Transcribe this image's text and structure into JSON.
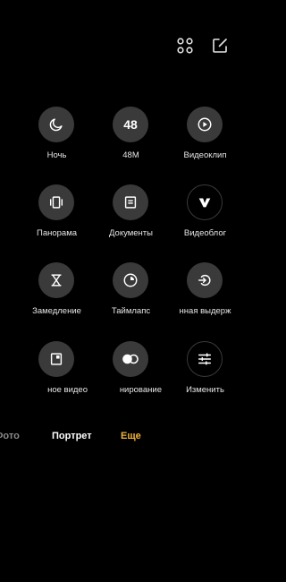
{
  "toolbar": {
    "icons": [
      "grid-icon",
      "edit-icon"
    ]
  },
  "modes": [
    {
      "label": "Ночь",
      "icon": "night-moon-icon"
    },
    {
      "label": "48M",
      "icon": "48m-icon",
      "text": "48"
    },
    {
      "label": "Видеоклип",
      "icon": "video-clip-icon"
    },
    {
      "label": "Панорама",
      "icon": "panorama-icon"
    },
    {
      "label": "Документы",
      "icon": "document-icon"
    },
    {
      "label": "Видеоблог",
      "icon": "vlog-icon"
    },
    {
      "label": "Замедление",
      "icon": "slow-motion-icon"
    },
    {
      "label": "Таймлапс",
      "icon": "timelapse-icon"
    },
    {
      "label": "нная выдерж",
      "icon": "long-exposure-icon"
    },
    {
      "label": "ное видео",
      "icon": "short-video-icon"
    },
    {
      "label": "нирование",
      "icon": "dual-video-icon"
    },
    {
      "label": "Изменить",
      "icon": "settings-sliders-icon"
    }
  ],
  "tabs": {
    "photo": "Фото",
    "portrait": "Портрет",
    "more": "Еще"
  },
  "colors": {
    "background": "#000000",
    "circle": "#3a3a3a",
    "active_tab": "#f2b53a",
    "inactive_tab": "#8a8a8a"
  }
}
